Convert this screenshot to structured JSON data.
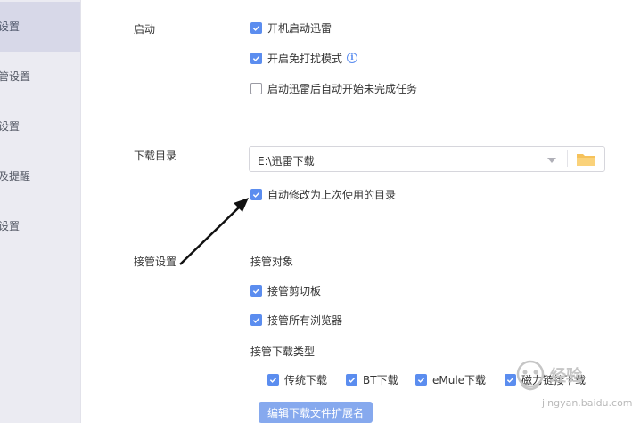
{
  "sidebar": {
    "items": [
      {
        "label": "设置"
      },
      {
        "label": "管设置"
      },
      {
        "label": "设置"
      },
      {
        "label": "及提醒"
      },
      {
        "label": "设置"
      }
    ]
  },
  "startup": {
    "label": "启动",
    "options": [
      {
        "label": "开机启动迅雷",
        "checked": true
      },
      {
        "label": "开启免打扰模式",
        "checked": true,
        "info_icon": "info-icon"
      },
      {
        "label": "启动迅雷后自动开始未完成任务",
        "checked": false
      }
    ]
  },
  "download_dir": {
    "label": "下载目录",
    "value": "E:\\迅雷下载",
    "auto_modify_label": "自动修改为上次使用的目录",
    "auto_modify_checked": true
  },
  "takeover": {
    "label": "接管设置",
    "target_label": "接管对象",
    "targets": [
      {
        "label": "接管剪切板",
        "checked": true
      },
      {
        "label": "接管所有浏览器",
        "checked": true
      }
    ],
    "type_label": "接管下载类型",
    "types": [
      {
        "label": "传统下载",
        "checked": true
      },
      {
        "label": "BT下载",
        "checked": true
      },
      {
        "label": "eMule下载",
        "checked": true
      },
      {
        "label": "磁力链接下载",
        "checked": true
      }
    ],
    "edit_button": "编辑下载文件扩展名"
  },
  "watermark": {
    "text": "jingyan.baidu.com"
  },
  "colors": {
    "accent": "#5b8def",
    "sidebar_bg": "#ebebf2",
    "sidebar_active": "#d7d8e8",
    "button": "#86a9ee"
  }
}
